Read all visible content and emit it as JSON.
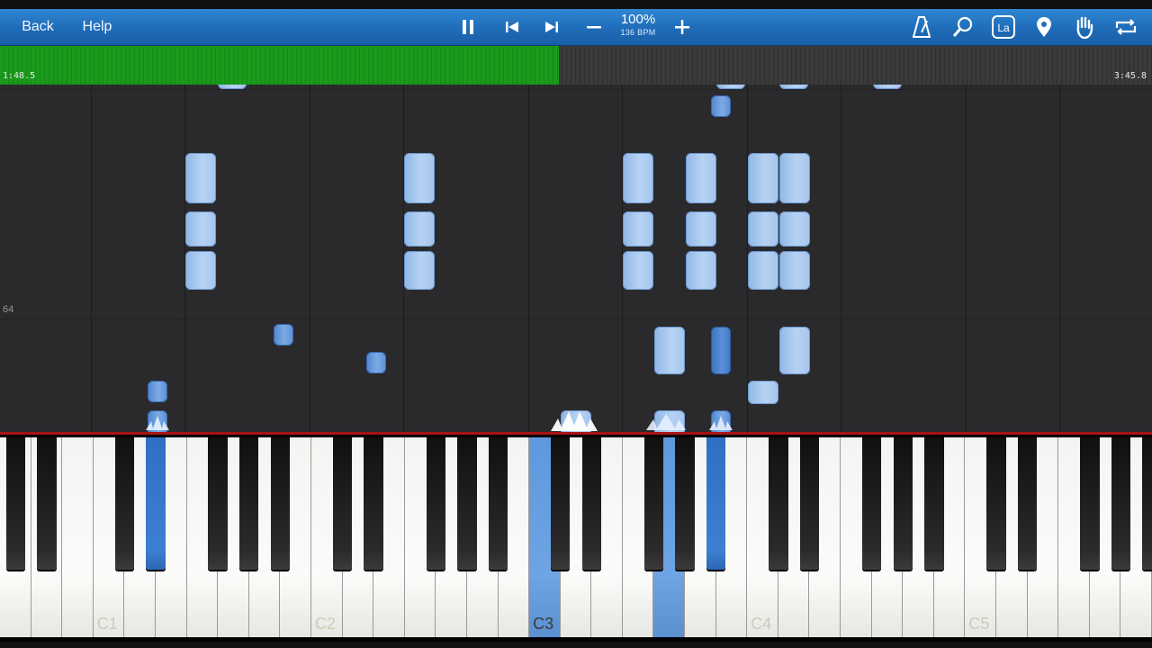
{
  "toolbar": {
    "back_label": "Back",
    "help_label": "Help",
    "tempo_percent": "100%",
    "tempo_bpm": "136 BPM",
    "icons": [
      "pause-icon",
      "skip-back-icon",
      "skip-forward-icon",
      "minus-icon",
      "plus-icon",
      "metronome-icon",
      "search-icon",
      "label-la-icon",
      "location-pin-icon",
      "hand-icon",
      "loop-icon"
    ],
    "label_icon_text": "La"
  },
  "progress": {
    "current_time": "1:48.5",
    "total_time": "3:45.8",
    "fraction": 0.485,
    "fill_color": "#1a9a1a"
  },
  "roll": {
    "measure_number": "64"
  },
  "keyboard": {
    "octave_labels": [
      "C1",
      "C2",
      "C3",
      "C4",
      "C5"
    ],
    "highlight_color": "#5f98dc"
  }
}
